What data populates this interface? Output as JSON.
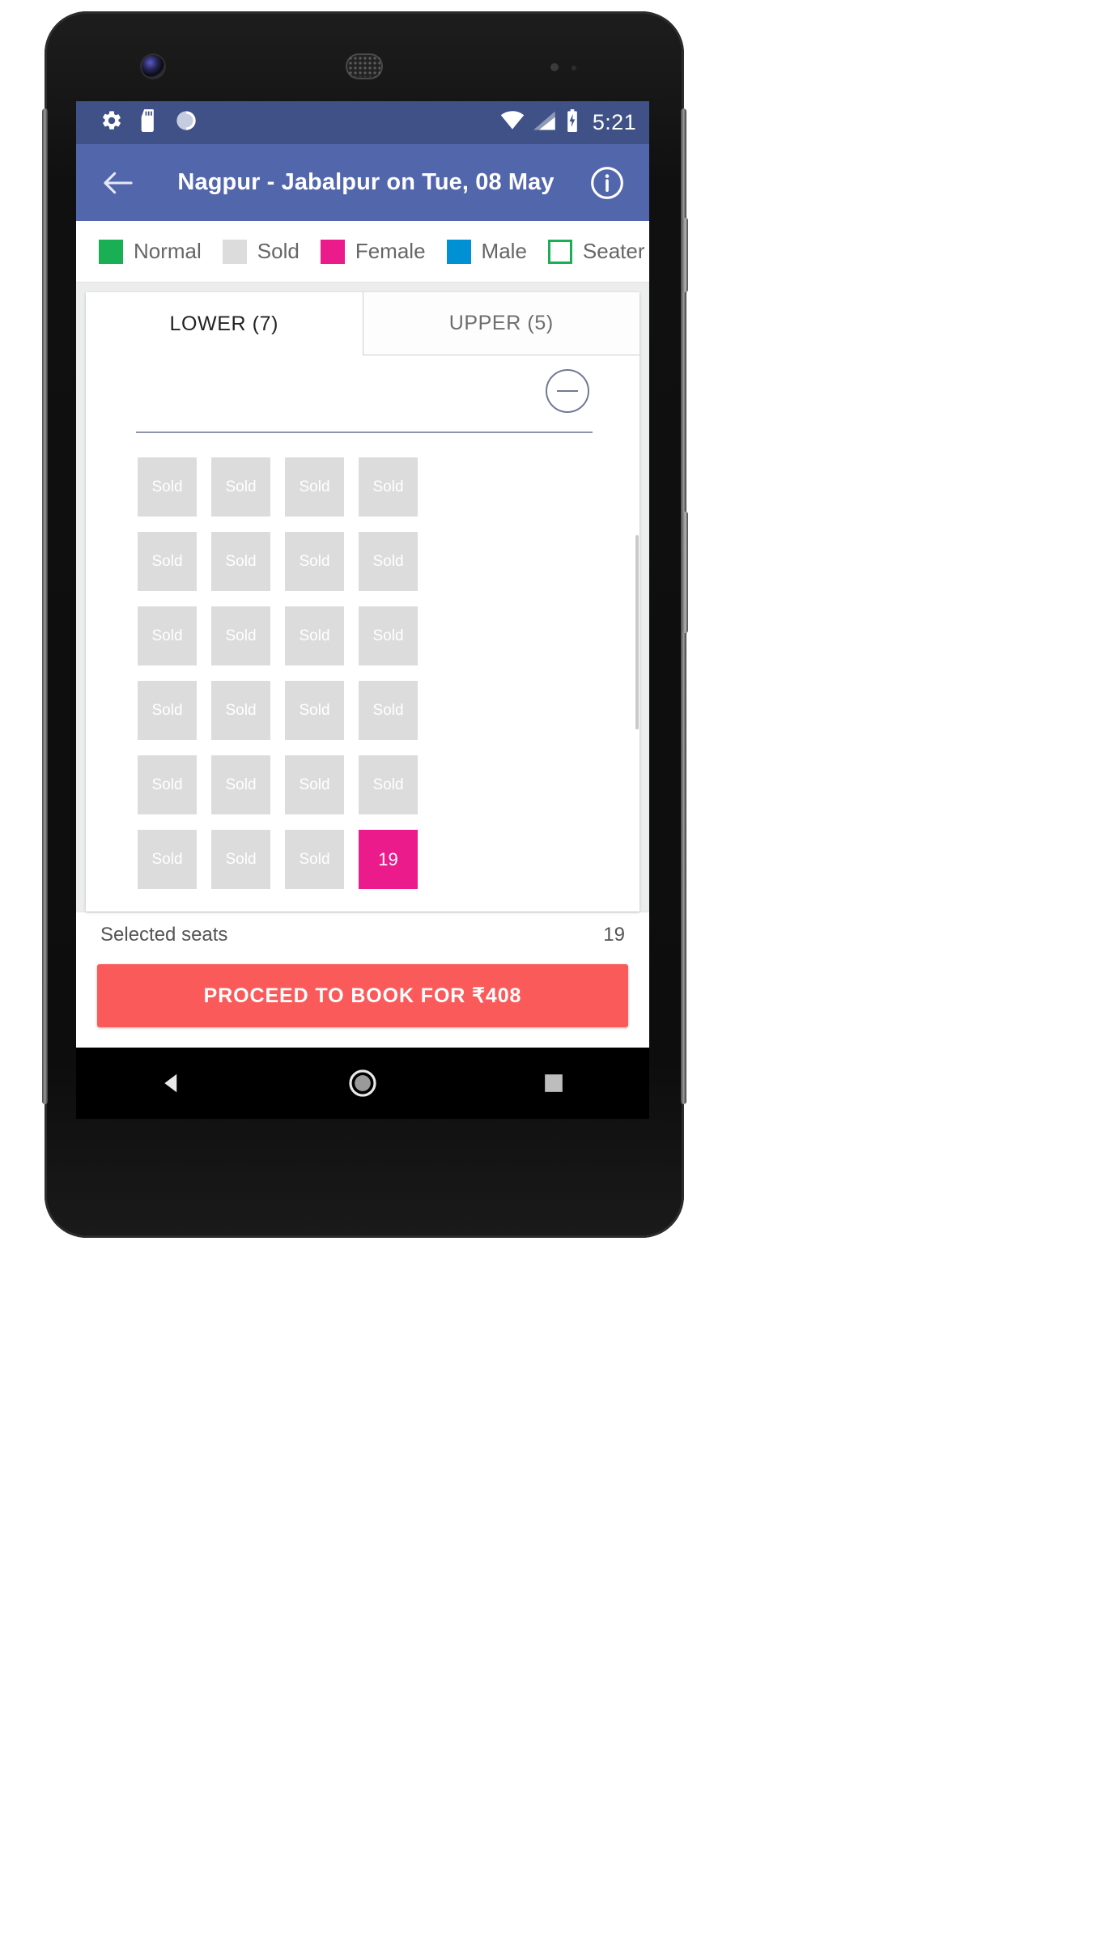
{
  "status_bar": {
    "left_icons": [
      "gear-icon",
      "sd-card-icon",
      "sync-circle-icon"
    ],
    "right_icons": [
      "wifi-icon",
      "signal-icon",
      "battery-icon"
    ],
    "time": "5:21",
    "background_color": "#3f5186"
  },
  "toolbar": {
    "back_icon": "back-arrow-icon",
    "title": "Nagpur - Jabalpur on Tue, 08 May",
    "info_icon": "info-icon",
    "background_color": "#5266ac"
  },
  "legend": {
    "items": [
      {
        "label": "Normal",
        "color": "#1aaf54",
        "style": "filled"
      },
      {
        "label": "Sold",
        "color": "#dcdcdc",
        "style": "filled"
      },
      {
        "label": "Female",
        "color": "#ec1b8c",
        "style": "filled"
      },
      {
        "label": "Male",
        "color": "#0091d5",
        "style": "filled"
      },
      {
        "label": "Seater",
        "color": "#1aaf54",
        "style": "outline"
      },
      {
        "label": "",
        "color": "#1aaf54",
        "style": "outline"
      }
    ]
  },
  "decks": {
    "tabs": [
      {
        "label": "LOWER (7)",
        "active": true
      },
      {
        "label": "UPPER (5)",
        "active": false
      }
    ],
    "collapse_icon": "minus-circle-icon"
  },
  "seat_map": {
    "sold_label": "Sold",
    "columns": [
      {
        "position": "left-1",
        "seats": [
          {
            "label": "Sold",
            "state": "sold"
          },
          {
            "label": "Sold",
            "state": "sold"
          },
          {
            "label": "Sold",
            "state": "sold"
          },
          {
            "label": "Sold",
            "state": "sold"
          },
          {
            "label": "Sold",
            "state": "sold"
          },
          {
            "label": "Sold",
            "state": "sold"
          }
        ]
      },
      {
        "position": "left-2",
        "seats": [
          {
            "label": "Sold",
            "state": "sold"
          },
          {
            "label": "Sold",
            "state": "sold"
          },
          {
            "label": "Sold",
            "state": "sold"
          },
          {
            "label": "Sold",
            "state": "sold"
          },
          {
            "label": "Sold",
            "state": "sold"
          },
          {
            "label": "Sold",
            "state": "sold"
          }
        ]
      },
      {
        "position": "right-1",
        "seats": [
          {
            "label": "Sold",
            "state": "sold"
          },
          {
            "label": "Sold",
            "state": "sold"
          },
          {
            "label": "Sold",
            "state": "sold"
          },
          {
            "label": "Sold",
            "state": "sold"
          },
          {
            "label": "Sold",
            "state": "sold"
          },
          {
            "label": "Sold",
            "state": "sold"
          }
        ]
      },
      {
        "position": "right-2",
        "seats": [
          {
            "label": "Sold",
            "state": "sold"
          },
          {
            "label": "Sold",
            "state": "sold"
          },
          {
            "label": "Sold",
            "state": "sold"
          },
          {
            "label": "Sold",
            "state": "sold"
          },
          {
            "label": "Sold",
            "state": "sold"
          },
          {
            "label": "19",
            "state": "selected"
          }
        ]
      }
    ]
  },
  "summary": {
    "label": "Selected seats",
    "value": "19"
  },
  "cta": {
    "label": "PROCEED TO BOOK FOR ₹408",
    "color": "#fa5a5a"
  },
  "nav_bar": {
    "buttons": [
      "back-triangle-icon",
      "home-circle-icon",
      "recents-square-icon"
    ]
  }
}
